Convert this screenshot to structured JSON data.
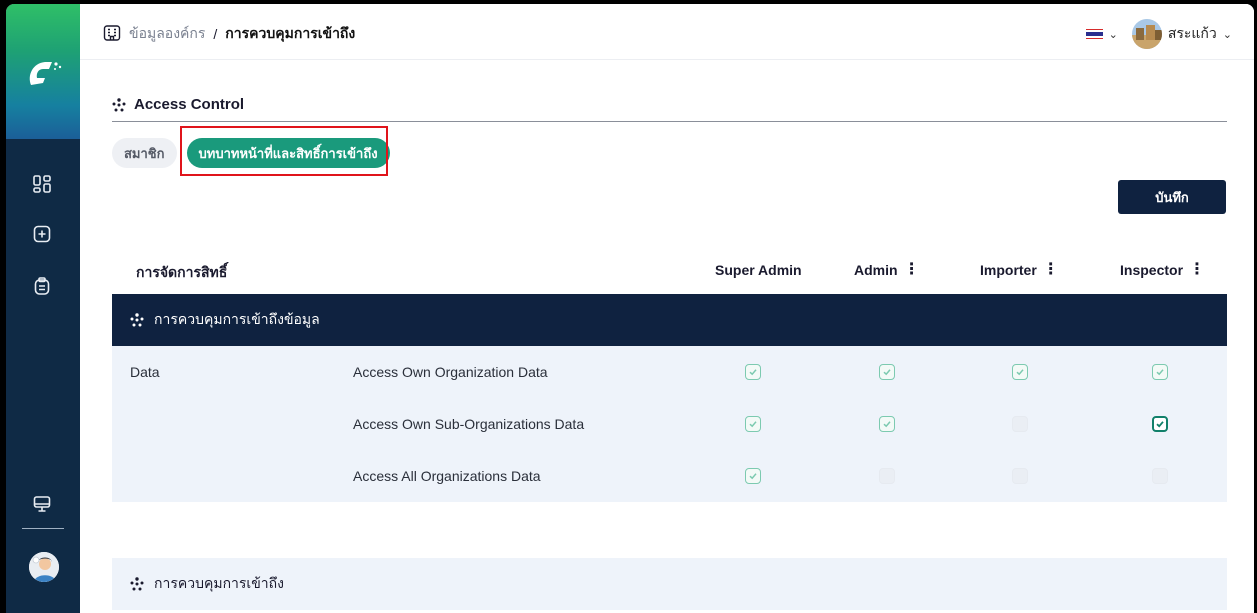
{
  "breadcrumb": {
    "parent": "ข้อมูลองค์กร",
    "separator": "/",
    "current": "การควบคุมการเข้าถึง"
  },
  "header": {
    "language_flag": "thai-flag",
    "user_name": "สระแก้ว"
  },
  "section": {
    "title": "Access Control"
  },
  "tabs": [
    {
      "label": "สมาชิก",
      "active": false
    },
    {
      "label": "บทบาทหน้าที่และสิทธิ์การเข้าถึง",
      "active": true
    }
  ],
  "save_label": "บันทึก",
  "table": {
    "header_label": "การจัดการสิทธิ์",
    "roles": [
      "Super Admin",
      "Admin",
      "Importer",
      "Inspector"
    ],
    "groups": [
      {
        "title": "การควบคุมการเข้าถึงข้อมูล",
        "category": "Data",
        "rows": [
          {
            "label": "Access Own Organization Data",
            "checks": [
              "checked",
              "checked",
              "checked",
              "checked"
            ]
          },
          {
            "label": "Access Own Sub-Organizations Data",
            "checks": [
              "checked",
              "checked",
              "empty",
              "checked-strong"
            ]
          },
          {
            "label": "Access All Organizations Data",
            "checks": [
              "checked",
              "empty",
              "empty",
              "empty"
            ]
          }
        ]
      },
      {
        "title": "การควบคุมการเข้าถึง"
      }
    ]
  },
  "colors": {
    "sidebar": "#0f2a45",
    "accent": "#1a9a7c",
    "navy": "#0f2240",
    "highlight": "#e0141b"
  }
}
